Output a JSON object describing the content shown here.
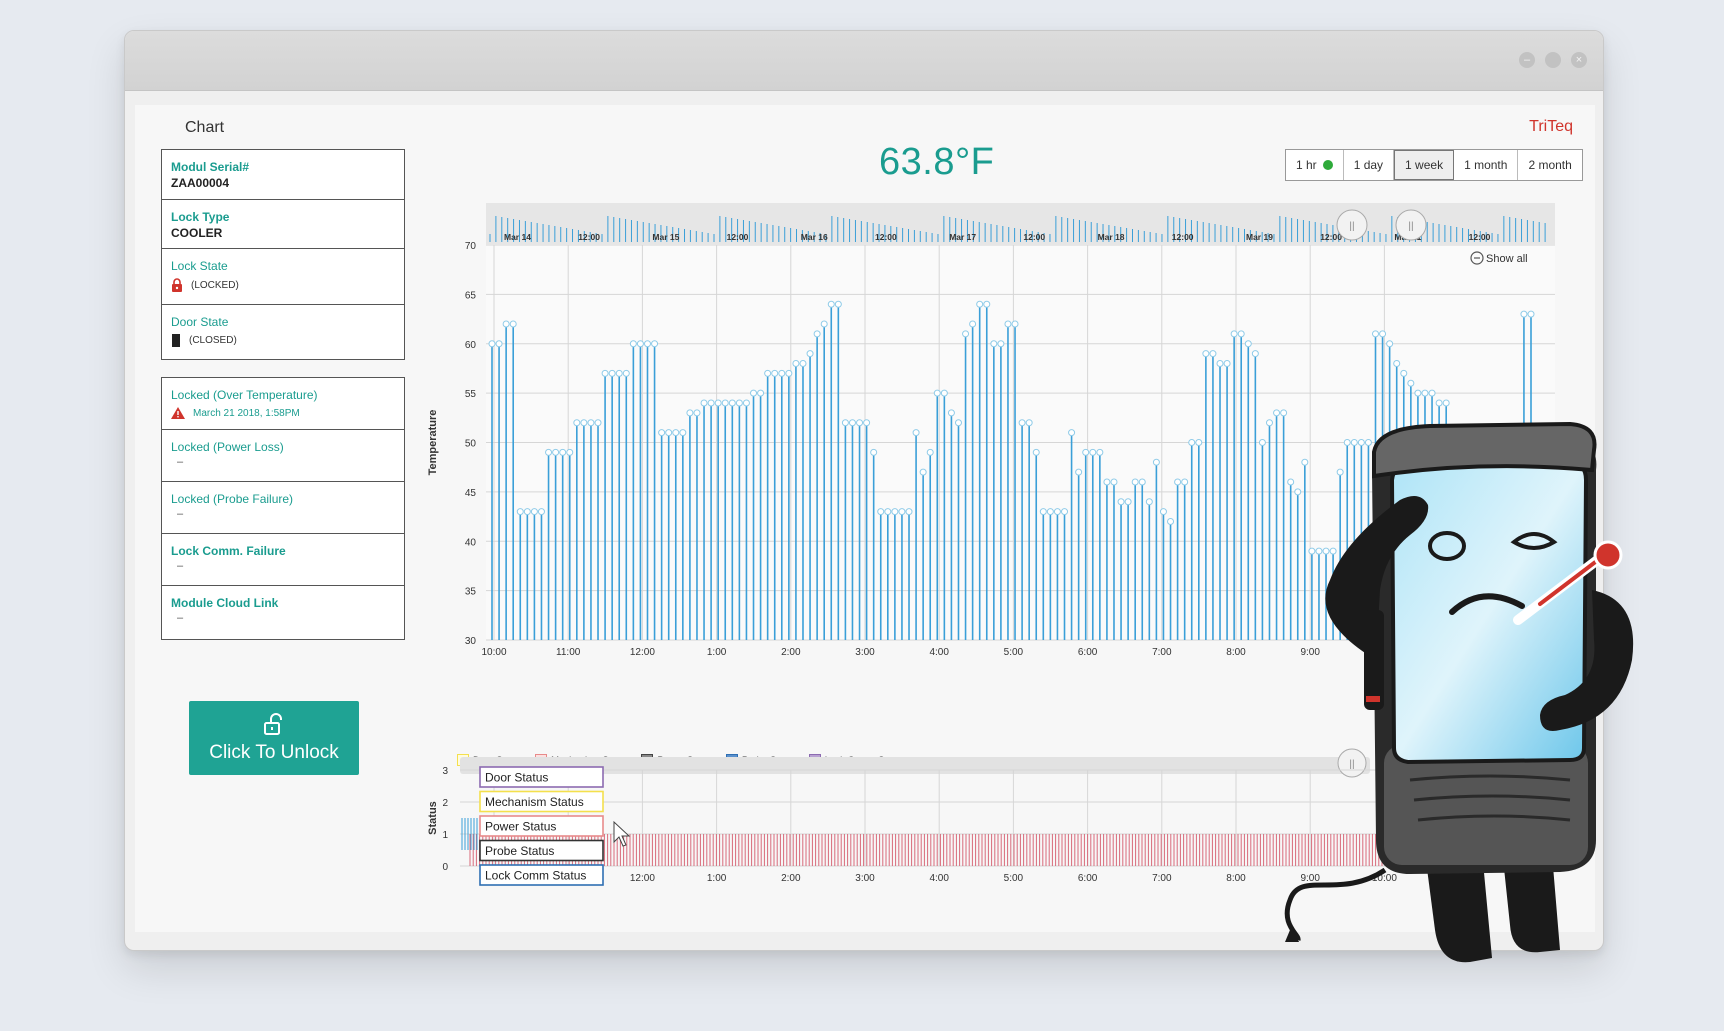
{
  "app": {
    "title": "Chart",
    "brand": "TriTeq",
    "temperature_readout": "63.8°F"
  },
  "range_buttons": [
    {
      "label": "1 hr",
      "indicator": "green-dot-icon"
    },
    {
      "label": "1 day"
    },
    {
      "label": "1 week",
      "active": true
    },
    {
      "label": "1 month"
    },
    {
      "label": "2 month"
    }
  ],
  "info": {
    "serial_label": "Modul Serial#",
    "serial_value": "ZAA00004",
    "lock_type_label": "Lock Type",
    "lock_type_value": "COOLER",
    "lock_state_label": "Lock State",
    "lock_state_value": "(LOCKED)",
    "door_state_label": "Door State",
    "door_state_value": "(CLOSED)"
  },
  "alerts": {
    "over_temp_label": "Locked (Over Temperature)",
    "over_temp_time": "March 21 2018, 1:58PM",
    "power_loss_label": "Locked (Power Loss)",
    "power_loss_value": "–",
    "probe_failure_label": "Locked (Probe Failure)",
    "probe_failure_value": "–",
    "comm_failure_label": "Lock Comm. Failure",
    "comm_failure_value": "–",
    "cloud_link_label": "Module Cloud Link",
    "cloud_link_value": "–"
  },
  "unlock_button": {
    "label": "Click To Unlock",
    "icon": "unlock-icon"
  },
  "show_all": "Show all",
  "legend": [
    {
      "label": "Door Status",
      "color": "#f4e04d"
    },
    {
      "label": "Mechanism Status",
      "color": "#e88a8a"
    },
    {
      "label": "Power Status",
      "color": "#555555"
    },
    {
      "label": "Probe Status",
      "color": "#2f6fb3"
    },
    {
      "label": "Lock Comm Status",
      "color": "#8c6bb1"
    }
  ],
  "status_popup": [
    {
      "label": "Door Status",
      "color": "#8c6bb1"
    },
    {
      "label": "Mechanism Status",
      "color": "#f4e04d"
    },
    {
      "label": "Power Status",
      "color": "#e88a8a"
    },
    {
      "label": "Probe Status",
      "color": "#333333"
    },
    {
      "label": "Lock Comm Status",
      "color": "#2f6fb3"
    }
  ],
  "chart_data": [
    {
      "type": "bar",
      "ylabel": "Temperature",
      "ylim": [
        30,
        70
      ],
      "yticks": [
        30,
        35,
        40,
        45,
        50,
        55,
        60,
        65,
        70
      ],
      "xticks": [
        "10:00",
        "11:00",
        "12:00",
        "1:00",
        "2:00",
        "3:00",
        "4:00",
        "5:00",
        "6:00",
        "7:00",
        "8:00",
        "9:00",
        "10:00"
      ],
      "navigator_labels": [
        "Mar 14",
        "12:00",
        "Mar 15",
        "12:00",
        "Mar 16",
        "12:00",
        "Mar 17",
        "12:00",
        "Mar 18",
        "12:00",
        "Mar 19",
        "12:00",
        "Mar 21",
        "12:00"
      ],
      "grid": true,
      "color": "#3a9fd8",
      "values": [
        60,
        60,
        62,
        62,
        43,
        43,
        43,
        43,
        49,
        49,
        49,
        49,
        52,
        52,
        52,
        52,
        57,
        57,
        57,
        57,
        60,
        60,
        60,
        60,
        51,
        51,
        51,
        51,
        53,
        53,
        54,
        54,
        54,
        54,
        54,
        54,
        54,
        55,
        55,
        57,
        57,
        57,
        57,
        58,
        58,
        59,
        61,
        62,
        64,
        64,
        52,
        52,
        52,
        52,
        49,
        43,
        43,
        43,
        43,
        43,
        51,
        47,
        49,
        55,
        55,
        53,
        52,
        61,
        62,
        64,
        64,
        60,
        60,
        62,
        62,
        52,
        52,
        49,
        43,
        43,
        43,
        43,
        51,
        47,
        49,
        49,
        49,
        46,
        46,
        44,
        44,
        46,
        46,
        44,
        48,
        43,
        42,
        46,
        46,
        50,
        50,
        59,
        59,
        58,
        58,
        61,
        61,
        60,
        59,
        50,
        52,
        53,
        53,
        46,
        45,
        48,
        39,
        39,
        39,
        39,
        47,
        50,
        50,
        50,
        50,
        61,
        61,
        60,
        58,
        57,
        56,
        55,
        55,
        55,
        54,
        54,
        51,
        51,
        51,
        51,
        51,
        51,
        51,
        51,
        51,
        51,
        63,
        63
      ]
    },
    {
      "type": "bar",
      "ylabel": "Status",
      "ylim": [
        0,
        3
      ],
      "yticks": [
        0,
        1,
        2,
        3
      ],
      "xticks": [
        "10:00",
        "11:00",
        "12:00",
        "1:00",
        "2:00",
        "3:00",
        "4:00",
        "5:00",
        "6:00",
        "7:00",
        "8:00",
        "9:00",
        "10:00"
      ],
      "series": [
        {
          "name": "Mechanism Status",
          "value": 0.5
        }
      ]
    }
  ]
}
